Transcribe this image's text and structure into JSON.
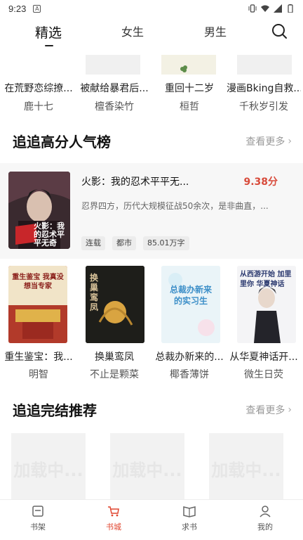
{
  "status_bar": {
    "time": "9:23",
    "badge": "A"
  },
  "top_tabs": [
    {
      "label": "精选",
      "active": true
    },
    {
      "label": "女生",
      "active": false
    },
    {
      "label": "男生",
      "active": false
    }
  ],
  "row1_books": [
    {
      "title": "在荒野恋综撩...",
      "author": "鹿十七"
    },
    {
      "title": "被献给暴君后...",
      "author": "檀香染竹"
    },
    {
      "title": "重回十二岁",
      "author": "桓哲"
    },
    {
      "title": "漫画Bking自救...",
      "author": "千秋岁引发"
    }
  ],
  "section_popular": {
    "title": "追追高分人气榜",
    "more": "查看更多"
  },
  "featured": {
    "title": "火影：我的忍术平平无...",
    "score": "9.38分",
    "description": "忍界四方，历代大规模征战50余次，是非曲直，...",
    "tags": [
      "连载",
      "都市",
      "85.01万字"
    ],
    "cover_text": "火影：我的忍术平平无奇"
  },
  "row2_books": [
    {
      "title": "重生鉴宝：我...",
      "author": "明智",
      "cover_text": "重生鉴宝 我真没想当专家"
    },
    {
      "title": "换巢鸾凤",
      "author": "不止是颗菜",
      "cover_text": "换巢鸾凤"
    },
    {
      "title": "总裁办新来的...",
      "author": "椰香薄饼",
      "cover_text": "总裁办新来的实习生"
    },
    {
      "title": "从华夏神话开...",
      "author": "微生日荧",
      "cover_text": "从西游开始 加里里你 华夏神话"
    }
  ],
  "section_finished": {
    "title": "追追完结推荐",
    "more": "查看更多"
  },
  "loading_text": "加载中...",
  "bottom_nav": [
    {
      "label": "书架",
      "icon": "bookshelf-icon",
      "active": false
    },
    {
      "label": "书城",
      "icon": "bookstore-cart-icon",
      "active": true
    },
    {
      "label": "求书",
      "icon": "request-book-icon",
      "active": false
    },
    {
      "label": "我的",
      "icon": "profile-icon",
      "active": false
    }
  ],
  "colors": {
    "accent": "#e0452f",
    "score": "#d84b3b"
  }
}
